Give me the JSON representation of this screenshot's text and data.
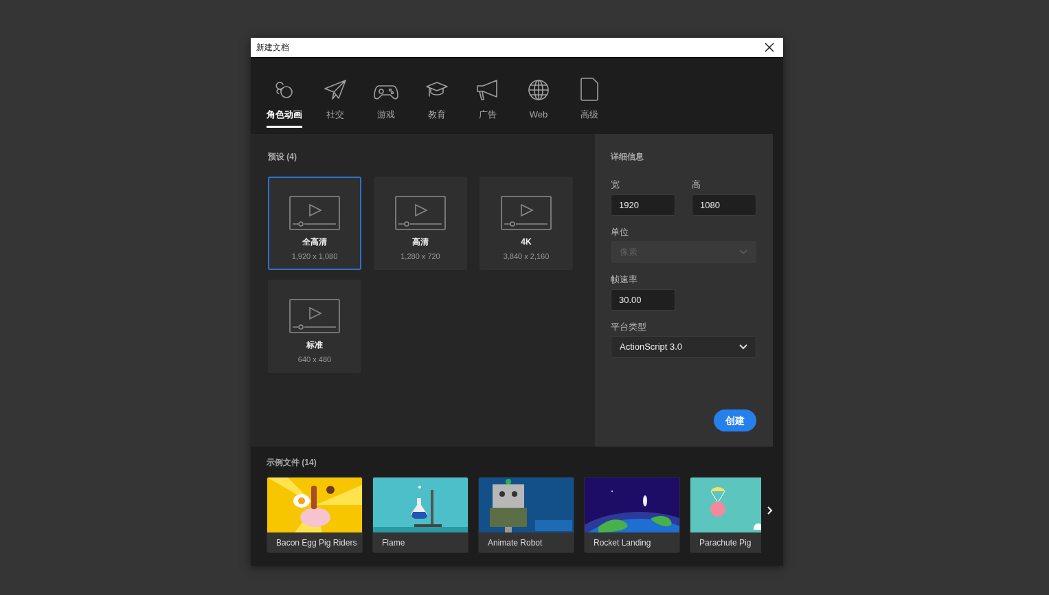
{
  "window": {
    "title": "新建文档"
  },
  "tabs": [
    {
      "label": "角色动画",
      "selected": true
    },
    {
      "label": "社交",
      "selected": false
    },
    {
      "label": "游戏",
      "selected": false
    },
    {
      "label": "教育",
      "selected": false
    },
    {
      "label": "广告",
      "selected": false
    },
    {
      "label": "Web",
      "selected": false
    },
    {
      "label": "高级",
      "selected": false
    }
  ],
  "presets": {
    "heading": "预设 (4)",
    "items": [
      {
        "name": "全高清",
        "size": "1,920 x 1,080",
        "selected": true
      },
      {
        "name": "高清",
        "size": "1,280 x 720",
        "selected": false
      },
      {
        "name": "4K",
        "size": "3,840 x 2,160",
        "selected": false
      },
      {
        "name": "标准",
        "size": "640 x 480",
        "selected": false
      }
    ]
  },
  "details": {
    "heading": "详细信息",
    "width": {
      "label": "宽",
      "value": "1920"
    },
    "height": {
      "label": "高",
      "value": "1080"
    },
    "unit": {
      "label": "单位",
      "value": "像素",
      "disabled": true
    },
    "frame_rate": {
      "label": "帧速率",
      "value": "30.00"
    },
    "platform": {
      "label": "平台类型",
      "value": "ActionScript 3.0",
      "disabled": false
    },
    "create_button": "创建"
  },
  "samples": {
    "heading": "示例文件 (14)",
    "items": [
      {
        "title": "Bacon Egg Pig Riders"
      },
      {
        "title": "Flame"
      },
      {
        "title": "Animate Robot"
      },
      {
        "title": "Rocket Landing"
      },
      {
        "title": "Parachute Pig"
      }
    ]
  }
}
